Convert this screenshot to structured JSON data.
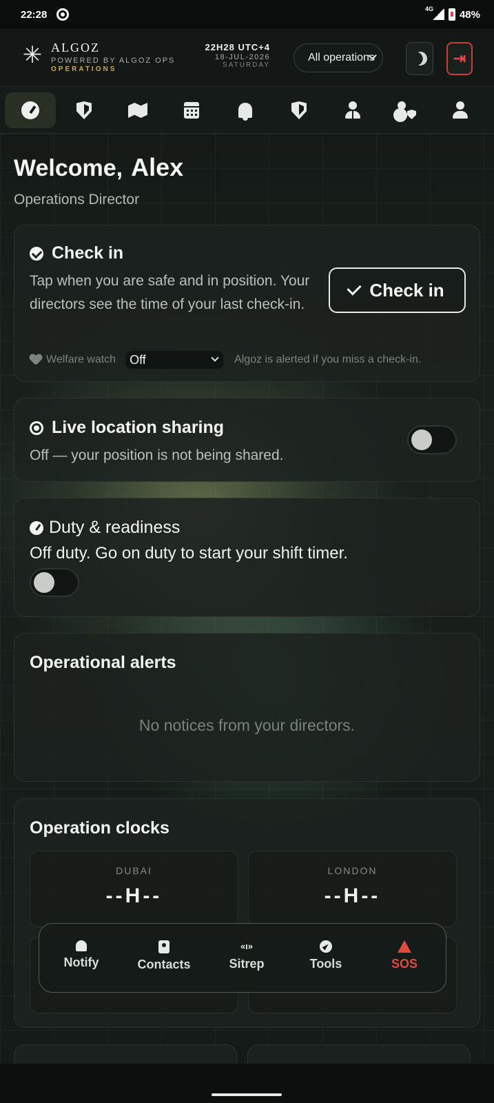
{
  "status_bar": {
    "time": "22:28",
    "network": "4G",
    "battery": "48%"
  },
  "header": {
    "brand_name": "ALGOZ",
    "brand_powered": "POWERED BY ALGOZ OPS",
    "brand_section": "OPERATIONS",
    "clock_time": "22H28 UTC+4",
    "clock_date": "18-JUL-2026",
    "clock_day": "SATURDAY",
    "operation_select": "All operations"
  },
  "tabs": [
    {
      "icon": "dashboard-gauge-icon",
      "active": true
    },
    {
      "icon": "shield-icon"
    },
    {
      "icon": "map-icon"
    },
    {
      "icon": "calendar-icon"
    },
    {
      "icon": "bell-icon"
    },
    {
      "icon": "shield-icon"
    },
    {
      "icon": "user-tie-icon"
    },
    {
      "icon": "user-shield-icon"
    },
    {
      "icon": "user-icon"
    }
  ],
  "welcome": {
    "greeting": "Welcome,",
    "name": "Alex",
    "role": "Operations Director"
  },
  "check_in": {
    "title": "Check in",
    "description": "Tap when you are safe and in position. Your directors see the time of your last check-in.",
    "button_label": "Check in",
    "welfare_label": "Welfare watch",
    "welfare_value": "Off",
    "welfare_note": "Algoz is alerted if you miss a check-in."
  },
  "location": {
    "title": "Live location sharing",
    "status": "Off — your position is not being shared.",
    "enabled": false
  },
  "duty": {
    "title": "Duty & readiness",
    "status": "Off duty. Go on duty to start your shift timer.",
    "enabled": false
  },
  "alerts": {
    "title": "Operational alerts",
    "empty_text": "No notices from your directors."
  },
  "clocks": {
    "title": "Operation clocks",
    "items": [
      {
        "city": "DUBAI",
        "time": "--H--"
      },
      {
        "city": "LONDON",
        "time": "--H--"
      }
    ]
  },
  "bottom_nav": [
    {
      "label": "Notify",
      "icon": "bell-icon"
    },
    {
      "label": "Contacts",
      "icon": "contacts-icon"
    },
    {
      "label": "Sitrep",
      "icon": "antenna-icon"
    },
    {
      "label": "Tools",
      "icon": "compass-icon"
    },
    {
      "label": "SOS",
      "icon": "warning-icon",
      "color": "#e14b3f"
    }
  ],
  "colors": {
    "accent_gold": "#c8a95a",
    "danger": "#d23a3a",
    "background": "#161b18"
  }
}
